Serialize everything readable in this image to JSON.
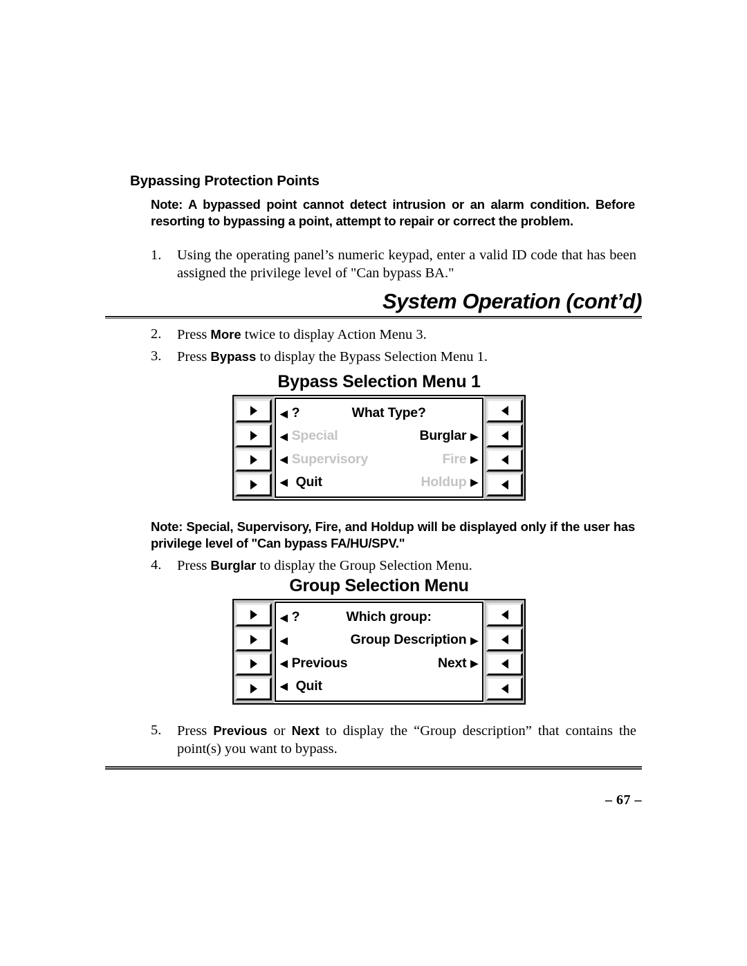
{
  "page": {
    "folio": "– 67 –",
    "running_head": "System Operation (cont’d)"
  },
  "section": {
    "title": "Bypassing Protection Points"
  },
  "notes": {
    "note_1": "Note: A bypassed point cannot detect intrusion or an alarm condition. Before resorting to bypassing a point, attempt to repair or correct the problem.",
    "note_2": "Note: Special, Supervisory, Fire, and Holdup will be displayed only if the user has privilege level of \"Can bypass FA/HU/SPV.\""
  },
  "steps": {
    "s1": {
      "num": "1.",
      "pre": "Using the operating panel’s numeric keypad, enter a valid ID code that has been assigned the privilege level of \"Can bypass BA.\""
    },
    "s2": {
      "num": "2.",
      "pre": "Press ",
      "bold": "More",
      "post": " twice to display Action Menu 3."
    },
    "s3": {
      "num": "3.",
      "pre": "Press ",
      "bold": "Bypass",
      "post": " to display the Bypass Selection Menu 1."
    },
    "s4": {
      "num": "4.",
      "pre": "Press ",
      "bold": "Burglar",
      "post": " to display the Group Selection Menu."
    },
    "s5": {
      "num": "5.",
      "pre": "Press ",
      "bold": "Previous",
      "mid": " or ",
      "bold2": "Next",
      "post": " to display the “Group description” that contains the point(s) you want to bypass."
    }
  },
  "figures": {
    "bypass_menu": {
      "title": "Bypass Selection Menu 1",
      "left_keys": [
        "▶",
        "▶",
        "▶",
        "▶"
      ],
      "right_keys": [
        "◀",
        "◀",
        "◀",
        "◀"
      ],
      "rows": [
        {
          "left_mark": "◀",
          "left_label": "?",
          "left_dim": false,
          "center_label": "What Type?",
          "right_label": "",
          "right_mark": "",
          "right_dim": false
        },
        {
          "left_mark": "◀",
          "left_label": "Special",
          "left_dim": true,
          "center_label": "",
          "right_label": "Burglar",
          "right_mark": "▶",
          "right_dim": false
        },
        {
          "left_mark": "◀",
          "left_label": "Supervisory",
          "left_dim": true,
          "center_label": "",
          "right_label": "Fire",
          "right_mark": "▶",
          "right_dim": true
        },
        {
          "left_mark": "◀",
          "left_label": "Quit",
          "left_dim": false,
          "center_label": "",
          "right_label": "Holdup",
          "right_mark": "▶",
          "right_dim": true
        }
      ]
    },
    "group_menu": {
      "title": "Group Selection Menu",
      "left_keys": [
        "▶",
        "▶",
        "▶",
        "▶"
      ],
      "right_keys": [
        "◀",
        "◀",
        "◀",
        "◀"
      ],
      "rows": [
        {
          "left_mark": "◀",
          "left_label": "?",
          "left_dim": false,
          "center_label": "Which group:",
          "right_label": "",
          "right_mark": "",
          "right_dim": false
        },
        {
          "left_mark": "◀",
          "left_label": "",
          "left_dim": false,
          "center_label": "",
          "right_label": "Group Description",
          "right_mark": "▶",
          "right_dim": false
        },
        {
          "left_mark": "◀",
          "left_label": "Previous",
          "left_dim": false,
          "center_label": "",
          "right_label": "Next",
          "right_mark": "▶",
          "right_dim": false
        },
        {
          "left_mark": "◀",
          "left_label": "Quit",
          "left_dim": false,
          "center_label": "",
          "right_label": "",
          "right_mark": "",
          "right_dim": false
        }
      ]
    }
  },
  "colors": {
    "text": "#000000",
    "dim_text": "#c4c4c4",
    "bezel": "#bfbfbf"
  }
}
